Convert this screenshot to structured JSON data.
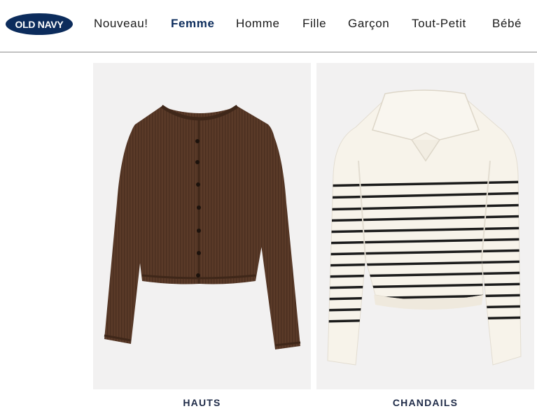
{
  "header": {
    "logo_text": "OLD NAVY",
    "nav": [
      {
        "label": "Nouveau!"
      },
      {
        "label": "Femme"
      },
      {
        "label": "Homme"
      },
      {
        "label": "Fille"
      },
      {
        "label": "Garçon"
      },
      {
        "label": "Tout-Petit"
      },
      {
        "label": "Bébé"
      }
    ],
    "active_nav": "Femme"
  },
  "categories": [
    {
      "label": "HAUTS",
      "image": "brown-ribbed-cardigan"
    },
    {
      "label": "CHANDAILS",
      "image": "striped-polo-sweater"
    }
  ],
  "colors": {
    "brand_navy": "#0c2c5c",
    "label_navy": "#1f2b48",
    "card_bg": "#f2f1f1",
    "cardigan_brown": "#5a3a28",
    "sweater_cream": "#f7f3ea",
    "stripe_black": "#1b1b1b"
  }
}
